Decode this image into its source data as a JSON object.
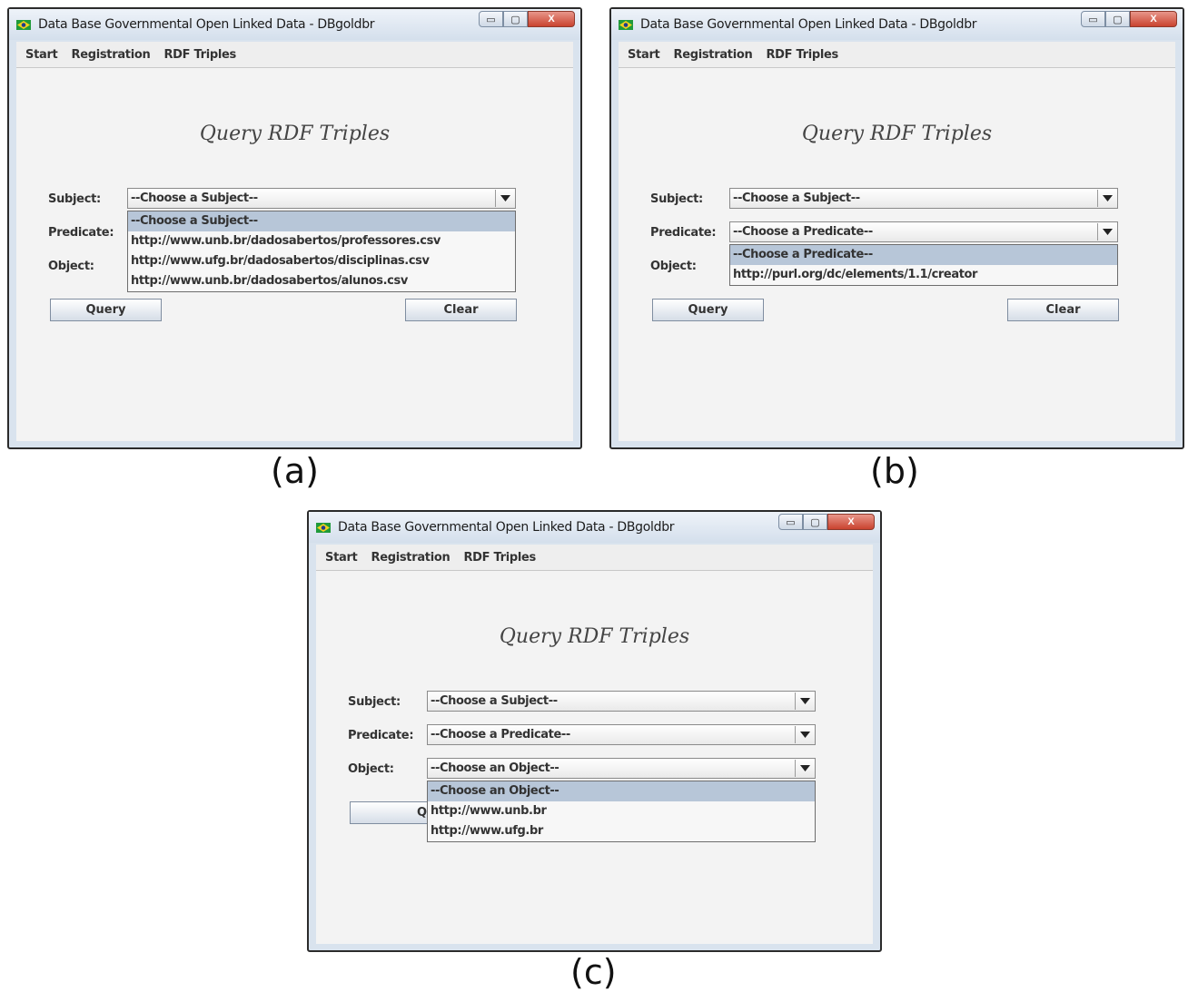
{
  "window": {
    "title": "Data Base Governmental Open Linked Data - DBgoldbr",
    "minimize_glyph": "▭",
    "maximize_glyph": "▢",
    "close_glyph": "X"
  },
  "menu": {
    "start": "Start",
    "registration": "Registration",
    "rdf_triples": "RDF Triples"
  },
  "form": {
    "heading": "Query RDF Triples",
    "subject_label": "Subject:",
    "predicate_label": "Predicate:",
    "object_label": "Object:",
    "query_button": "Query",
    "clear_button": "Clear"
  },
  "combos": {
    "subject_value": "--Choose a Subject--",
    "predicate_value": "--Choose a Predicate--",
    "object_value": "--Choose an Object--"
  },
  "dropdowns": {
    "subject_options": [
      "--Choose a Subject--",
      "http://www.unb.br/dadosabertos/professores.csv",
      "http://www.ufg.br/dadosabertos/disciplinas.csv",
      "http://www.unb.br/dadosabertos/alunos.csv"
    ],
    "predicate_options": [
      "--Choose a Predicate--",
      "http://purl.org/dc/elements/1.1/creator"
    ],
    "object_options": [
      "--Choose an Object--",
      "http://www.unb.br",
      "http://www.ufg.br"
    ]
  },
  "captions": {
    "a": "(a)",
    "b": "(b)",
    "c": "(c)"
  },
  "colors": {
    "selected_item": "#b7c6d8",
    "close_button": "#c9432f",
    "window_frame": "#2b2b2b"
  },
  "icons": {
    "app": "brazil-flag-icon",
    "dropdown": "chevron-down-icon"
  }
}
